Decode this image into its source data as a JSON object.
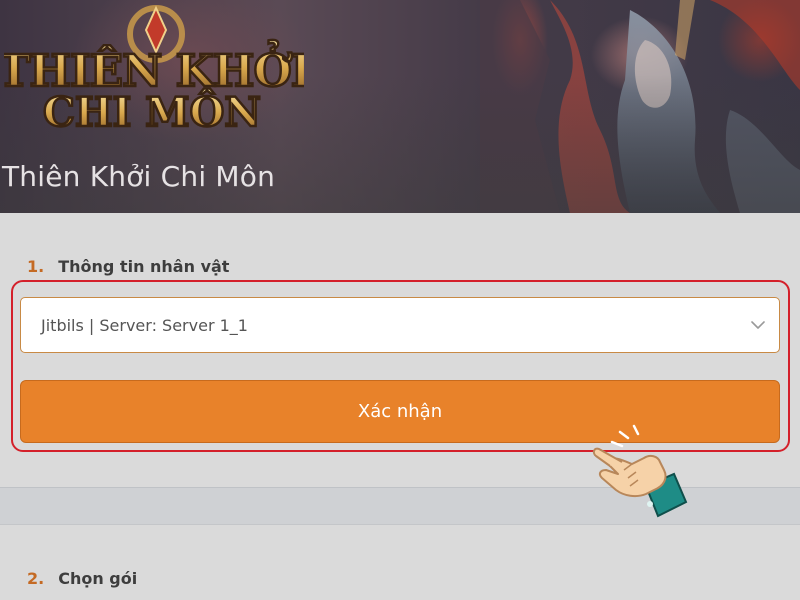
{
  "banner": {
    "logo_text_line1": "THIÊN KHỞI",
    "logo_text_line2": "CHI MÔN",
    "game_title": "Thiên Khởi Chi Môn"
  },
  "section1": {
    "number": "1.",
    "title": "Thông tin nhân vật",
    "character_select": {
      "selected_value": "Jitbils | Server: Server 1_1"
    },
    "confirm_label": "Xác nhận"
  },
  "section2": {
    "number": "2.",
    "title": "Chọn gói"
  },
  "colors": {
    "accent_orange": "#e8822a",
    "highlight_red": "#d4202a",
    "section_number": "#c46a24"
  },
  "icons": {
    "select_arrow": "chevron-down-icon",
    "pointer": "hand-pointer-icon"
  }
}
